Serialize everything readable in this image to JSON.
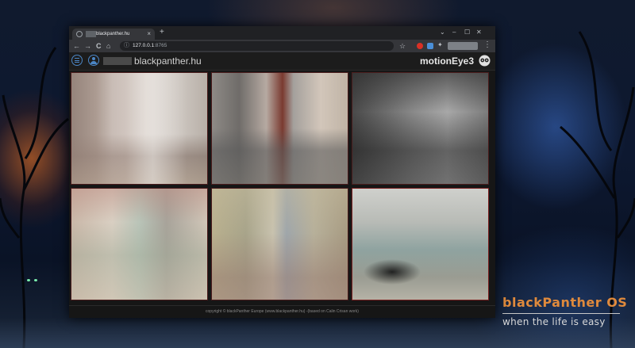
{
  "browser": {
    "tab_title": "blackpanther.hu",
    "new_tab": "+",
    "tab_close": "×",
    "window_controls": {
      "dropdown": "⌄",
      "minimize": "–",
      "maximize": "☐",
      "close": "✕"
    },
    "nav": {
      "back": "←",
      "forward": "→",
      "reload": "C",
      "home": "⌂"
    },
    "info_icon": "ⓘ",
    "url_host": "127.0.0.1",
    "url_port": ":8765",
    "star": "☆",
    "menu": "⋮",
    "extension_colors": [
      "#d93025",
      "#4a8fd8",
      "#9aa0a6"
    ]
  },
  "app": {
    "hostname": "blackpanther.hu",
    "brand": "motionEye3",
    "accent_color": "#4b86c6",
    "cameras": [
      {
        "id": "cam-1",
        "highlight": false
      },
      {
        "id": "cam-2",
        "highlight": false
      },
      {
        "id": "cam-3",
        "highlight": false
      },
      {
        "id": "cam-4",
        "highlight": false
      },
      {
        "id": "cam-5",
        "highlight": false
      },
      {
        "id": "cam-6",
        "highlight": true
      }
    ],
    "footer": "copyright © blackPanther Europe (www.blackpanther.hu) -(based on Calin Crisan work)"
  },
  "desktop": {
    "brand_title": "blackPanther OS",
    "brand_slogan": "when the life is easy",
    "brand_color": "#e08a3c"
  }
}
